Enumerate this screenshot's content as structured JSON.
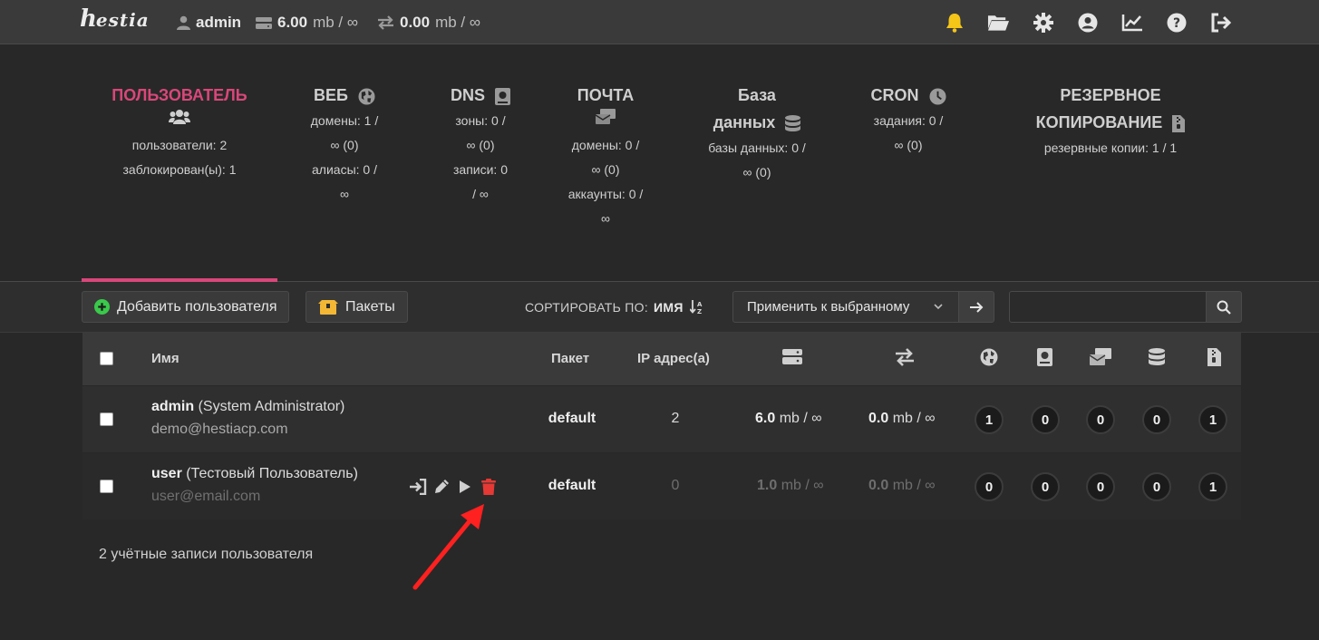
{
  "brand": {
    "logo_main": "h",
    "logo_rest": "estia"
  },
  "topbar": {
    "user": "admin",
    "disk_used": "6.00",
    "disk_unit": "mb / ∞",
    "bw_used": "0.00",
    "bw_unit": "mb / ∞",
    "icons": [
      "bell-icon",
      "folder-icon",
      "gear-icon",
      "user-circle-icon",
      "chart-line-icon",
      "help-icon",
      "logout-icon"
    ]
  },
  "overview": {
    "user": {
      "title": "ПОЛЬЗОВАТЕЛЬ",
      "lines": [
        "пользователи: 2",
        "заблокирован(ы): 1"
      ]
    },
    "web": {
      "title": "ВЕБ",
      "lines": [
        "домены: 1 /",
        "∞ (0)",
        "алиасы: 0 /",
        "∞"
      ]
    },
    "dns": {
      "title": "DNS",
      "lines": [
        "зоны: 0 /",
        "∞ (0)",
        "записи: 0",
        "/ ∞"
      ]
    },
    "mail": {
      "title": "ПОЧТА",
      "lines": [
        "домены: 0 /",
        "∞ (0)",
        "аккаунты: 0 /",
        "∞"
      ]
    },
    "db": {
      "title_line1": "База",
      "title_line2": "данных",
      "lines": [
        "базы данных: 0 /",
        "∞ (0)"
      ]
    },
    "cron": {
      "title": "CRON",
      "lines": [
        "задания: 0 /",
        "∞ (0)"
      ]
    },
    "backup": {
      "title_line1": "РЕЗЕРВНОЕ",
      "title_line2": "КОПИРОВАНИЕ",
      "lines": [
        "резервные копии: 1 / 1"
      ]
    }
  },
  "toolbar": {
    "add_user": "Добавить пользователя",
    "packages": "Пакеты",
    "sort_label": "СОРТИРОВАТЬ ПО:",
    "sort_value": "ИМЯ",
    "apply_select": "Применить к выбранному",
    "search_placeholder": ""
  },
  "table": {
    "headers": {
      "name": "Имя",
      "package": "Пакет",
      "ip": "IP адрес(а)"
    },
    "header_icons": [
      "disk-icon",
      "bandwidth-icon",
      "web-globe-icon",
      "dns-book-icon",
      "mail-icon",
      "database-icon",
      "backup-file-icon"
    ],
    "rows": [
      {
        "username": "admin",
        "fullname": " (System Administrator)",
        "email": "demo@hestiacp.com",
        "package": "default",
        "ips": "2",
        "disk_val": "6.0",
        "disk_unit": " mb / ∞",
        "bw_val": "0.0",
        "bw_unit": " mb / ∞",
        "counts": [
          "1",
          "0",
          "0",
          "0",
          "1"
        ]
      },
      {
        "username": "user",
        "fullname": " (Тестовый Пользователь)",
        "email": "user@email.com",
        "package": "default",
        "ips": "0",
        "disk_val": "1.0",
        "disk_unit": " mb / ∞",
        "bw_val": "0.0",
        "bw_unit": " mb / ∞",
        "counts": [
          "0",
          "0",
          "0",
          "0",
          "1"
        ]
      }
    ]
  },
  "footer": {
    "count_text": "2 учётные записи пользователя"
  },
  "colors": {
    "accent": "#d9477a",
    "bell": "#f5c518",
    "delete": "#e53935",
    "annotation": "#ff2020",
    "add_green": "#3ac94b",
    "packages_yellow": "#f3b735"
  }
}
